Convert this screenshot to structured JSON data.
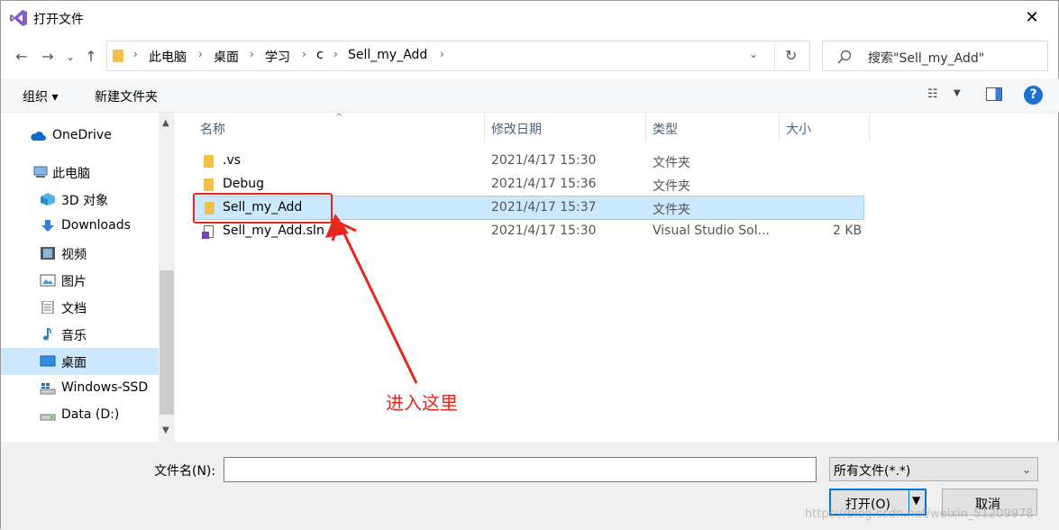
{
  "window": {
    "title": "打开文件",
    "close": "✕"
  },
  "nav_buttons": {
    "back": "←",
    "forward": "→",
    "recent": "⌄",
    "up": "↑"
  },
  "address": {
    "crumbs": [
      "此电脑",
      "桌面",
      "学习",
      "c",
      "Sell_my_Add"
    ],
    "separator": "›",
    "dropdown": "⌄",
    "refresh": "↻"
  },
  "search": {
    "placeholder": "搜索\"Sell_my_Add\"",
    "icon": "search-icon"
  },
  "toolbar": {
    "organize": "组织 ▾",
    "new_folder": "新建文件夹",
    "view": "☷",
    "view_drop": "▼",
    "help": "?"
  },
  "sidebar": {
    "items": [
      {
        "label": "OneDrive",
        "icon": "cloud-icon"
      },
      {
        "label": "此电脑",
        "icon": "computer-icon"
      },
      {
        "label": "3D 对象",
        "icon": "cube-icon"
      },
      {
        "label": "Downloads",
        "icon": "download-icon"
      },
      {
        "label": "视频",
        "icon": "video-icon"
      },
      {
        "label": "图片",
        "icon": "picture-icon"
      },
      {
        "label": "文档",
        "icon": "document-icon"
      },
      {
        "label": "音乐",
        "icon": "music-icon"
      },
      {
        "label": "桌面",
        "icon": "desktop-icon",
        "selected": true
      },
      {
        "label": "Windows-SSD",
        "icon": "drive-icon"
      },
      {
        "label": "Data (D:)",
        "icon": "drive-icon"
      }
    ],
    "scroll_up": "▲",
    "scroll_down": "▼"
  },
  "columns": {
    "name": "名称",
    "modified": "修改日期",
    "type": "类型",
    "size": "大小",
    "sort_caret": "^"
  },
  "files": [
    {
      "name": ".vs",
      "modified": "2021/4/17 15:30",
      "type": "文件夹",
      "size": "",
      "kind": "folder"
    },
    {
      "name": "Debug",
      "modified": "2021/4/17 15:36",
      "type": "文件夹",
      "size": "",
      "kind": "folder"
    },
    {
      "name": "Sell_my_Add",
      "modified": "2021/4/17 15:37",
      "type": "文件夹",
      "size": "",
      "kind": "folder",
      "selected": true
    },
    {
      "name": "Sell_my_Add.sln",
      "modified": "2021/4/17 15:30",
      "type": "Visual Studio Sol...",
      "size": "2 KB",
      "kind": "sln"
    }
  ],
  "annotation": {
    "text": "进入这里",
    "color": "#e8261c"
  },
  "bottom": {
    "filename_label": "文件名(N):",
    "filename_value": "",
    "filter": "所有文件(*.*)",
    "open": "打开(O)",
    "cancel": "取消",
    "watermark": "https://blog.csdn.net/weixin_51209978"
  },
  "colors": {
    "selection": "#cce8ff",
    "accent": "#0078d7",
    "annotation": "#e8261c"
  }
}
